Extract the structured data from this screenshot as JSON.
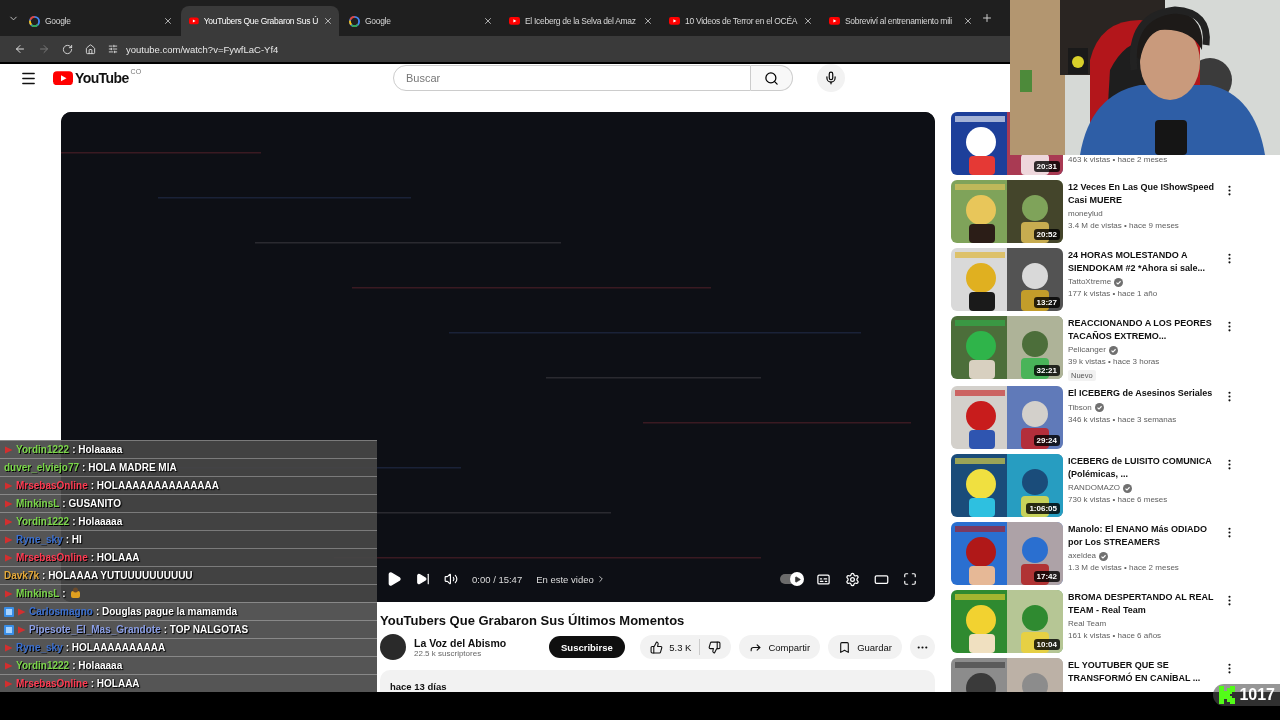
{
  "browser": {
    "tabs": [
      {
        "title": "Google",
        "kind": "google",
        "selected": false
      },
      {
        "title": "YouTubers Que Grabaron Sus Ú",
        "kind": "youtube",
        "selected": true
      },
      {
        "title": "Google",
        "kind": "google",
        "selected": false
      },
      {
        "title": "El Iceberg de la Selva del Amaz",
        "kind": "youtube",
        "selected": false
      },
      {
        "title": "10 Videos de Terror en el OCÉA",
        "kind": "youtube",
        "selected": false
      },
      {
        "title": "Sobreviví al entrenamiento mili",
        "kind": "youtube",
        "selected": false
      }
    ],
    "forward_enabled": false,
    "address": "youtube.com/watch?v=FywfLaC-Yf4"
  },
  "header": {
    "logo": "YouTube",
    "country": "CO",
    "search": {
      "placeholder": "Buscar"
    }
  },
  "player": {
    "time": "0:00 / 15:47",
    "chapters": "En este video",
    "autoplay": true
  },
  "video": {
    "title": "YouTubers Que Grabaron Sus Últimos Momentos",
    "channel": "La Voz del Abismo",
    "subscribers": "22.5 k suscriptores",
    "subscribe": "Suscribirse",
    "likes": "5.3 K",
    "share": "Compartir",
    "save": "Guardar",
    "date": "hace 13 días"
  },
  "sidebar": {
    "videos": [
      {
        "meta": "463 k vistas • hace 2 meses",
        "duration": "20:31"
      },
      {
        "title": "12 Veces En Las Que IShowSpeed Casi MUERE",
        "channel": "moneylud",
        "verified": false,
        "meta": "3.4 M de vistas • hace 9 meses",
        "duration": "20:52"
      },
      {
        "title": "24 HORAS MOLESTANDO A SIENDOKAM #2 *Ahora si sale...",
        "channel": "TattoXtreme",
        "verified": true,
        "meta": "177 k vistas • hace 1 año",
        "duration": "13:27"
      },
      {
        "title": "REACCIONANDO A LOS PEORES TACAÑOS EXTREMO...",
        "channel": "Pelicanger",
        "verified": true,
        "meta": "39 k vistas • hace 3 horas",
        "badge": "Nuevo",
        "duration": "32:21"
      },
      {
        "title": "El ICEBERG de Asesinos Seriales",
        "channel": "Tibson",
        "verified": true,
        "meta": "346 k vistas • hace 3 semanas",
        "duration": "29:24"
      },
      {
        "title": "ICEBERG de LUISITO COMUNICA (Polémicas, ...",
        "channel": "RANDOMAZO",
        "verified": true,
        "meta": "730 k vistas • hace 6 meses",
        "duration": "1:06:05"
      },
      {
        "title": "Manolo: El ENANO Más ODIADO por Los STREAMERS",
        "channel": "axeldea",
        "verified": true,
        "meta": "1.3 M de vistas • hace 2 meses",
        "duration": "17:42"
      },
      {
        "title": "BROMA DESPERTANDO AL REAL TEAM - Real Team",
        "channel": "Real Team",
        "verified": false,
        "meta": "161 k vistas • hace 6 años",
        "duration": "10:04"
      },
      {
        "title": "EL YOUTUBER QUE SE TRANSFORMÓ EN CANÍBAL ..."
      }
    ]
  },
  "chat": {
    "messages": [
      {
        "kind": "text",
        "name": "Yordin1222",
        "color": "#7bd64a",
        "platform": true,
        "sub_badge": false,
        "message": ": Holaaaaa"
      },
      {
        "kind": "text",
        "name": "duver_elviejo77",
        "color": "#7bd64a",
        "platform": false,
        "sub_badge": false,
        "message": ": HOLA MADRE MIA"
      },
      {
        "kind": "text",
        "name": "MrsebasOnline",
        "color": "#ff3b52",
        "platform": true,
        "sub_badge": false,
        "message": ": HOLAAAAAAAAAAAAAA"
      },
      {
        "kind": "text",
        "name": "MinkinsL",
        "color": "#7bd64a",
        "platform": true,
        "sub_badge": false,
        "message": ": GUSANITO"
      },
      {
        "kind": "text",
        "name": "Yordin1222",
        "color": "#7bd64a",
        "platform": true,
        "sub_badge": false,
        "message": ": Holaaaaa"
      },
      {
        "kind": "text",
        "name": "Ryne_sky",
        "color": "#3a6fd0",
        "platform": true,
        "sub_badge": false,
        "message": ": HI"
      },
      {
        "kind": "text",
        "name": "MrsebasOnline",
        "color": "#ff3b52",
        "platform": true,
        "sub_badge": false,
        "message": ": HOLAAA"
      },
      {
        "kind": "text",
        "name": "Davk7k",
        "color": "#e4a93a",
        "platform": false,
        "sub_badge": false,
        "message": ": HOLAAAA YUTUUUUUUUUUU"
      },
      {
        "kind": "emote",
        "name": "MinkinsL",
        "color": "#7bd64a",
        "platform": true,
        "sub_badge": false,
        "message": ":"
      },
      {
        "kind": "text",
        "name": "Carlosmagno",
        "color": "#3a6fd0",
        "platform": true,
        "sub_badge": true,
        "message": ": Douglas pague la mamamda"
      },
      {
        "kind": "text",
        "name": "Pipesote_El_Mas_Grandote",
        "color": "#8a9ee6",
        "platform": true,
        "sub_badge": true,
        "message": ": TOP NALGOTAS"
      },
      {
        "kind": "text",
        "name": "Ryne_sky",
        "color": "#3a6fd0",
        "platform": true,
        "sub_badge": false,
        "message": ": HOLAAAAAAAAAA"
      },
      {
        "kind": "text",
        "name": "Yordin1222",
        "color": "#7bd64a",
        "platform": true,
        "sub_badge": false,
        "message": ": Holaaaaa"
      },
      {
        "kind": "text",
        "name": "MrsebasOnline",
        "color": "#ff3b52",
        "platform": true,
        "sub_badge": false,
        "message": ": HOLAAA"
      }
    ]
  },
  "stream": {
    "viewers": "1017"
  }
}
